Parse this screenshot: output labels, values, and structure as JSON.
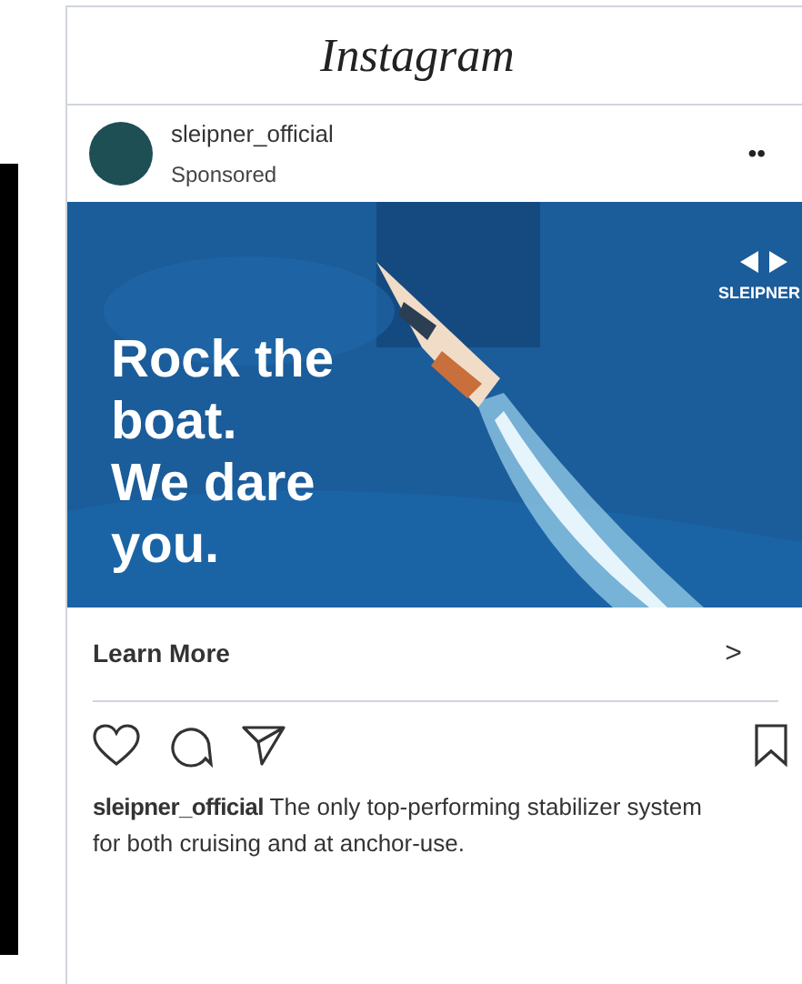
{
  "app": {
    "title": "Instagram"
  },
  "post": {
    "account": "sleipner_official",
    "label": "Sponsored",
    "more": "••",
    "image": {
      "headline": [
        "Rock the",
        "boat.",
        "We dare",
        "you."
      ],
      "brand": "SLEIPNER"
    },
    "cta": {
      "label": "Learn More",
      "chevron": ">"
    },
    "caption": {
      "account": "sleipner_official",
      "text": "The only top-performing stabilizer system for both cruising and at anchor-use."
    }
  }
}
